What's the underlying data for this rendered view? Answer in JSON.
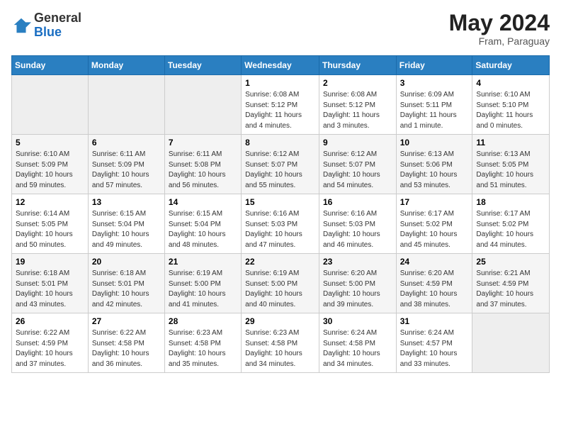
{
  "header": {
    "logo": {
      "general": "General",
      "blue": "Blue"
    },
    "title": "May 2024",
    "location": "Fram, Paraguay"
  },
  "weekdays": [
    "Sunday",
    "Monday",
    "Tuesday",
    "Wednesday",
    "Thursday",
    "Friday",
    "Saturday"
  ],
  "weeks": [
    [
      {
        "day": "",
        "empty": true
      },
      {
        "day": "",
        "empty": true
      },
      {
        "day": "",
        "empty": true
      },
      {
        "day": "1",
        "sunrise": "6:08 AM",
        "sunset": "5:12 PM",
        "daylight": "11 hours and 4 minutes."
      },
      {
        "day": "2",
        "sunrise": "6:08 AM",
        "sunset": "5:12 PM",
        "daylight": "11 hours and 3 minutes."
      },
      {
        "day": "3",
        "sunrise": "6:09 AM",
        "sunset": "5:11 PM",
        "daylight": "11 hours and 1 minute."
      },
      {
        "day": "4",
        "sunrise": "6:10 AM",
        "sunset": "5:10 PM",
        "daylight": "11 hours and 0 minutes."
      }
    ],
    [
      {
        "day": "5",
        "sunrise": "6:10 AM",
        "sunset": "5:09 PM",
        "daylight": "10 hours and 59 minutes."
      },
      {
        "day": "6",
        "sunrise": "6:11 AM",
        "sunset": "5:09 PM",
        "daylight": "10 hours and 57 minutes."
      },
      {
        "day": "7",
        "sunrise": "6:11 AM",
        "sunset": "5:08 PM",
        "daylight": "10 hours and 56 minutes."
      },
      {
        "day": "8",
        "sunrise": "6:12 AM",
        "sunset": "5:07 PM",
        "daylight": "10 hours and 55 minutes."
      },
      {
        "day": "9",
        "sunrise": "6:12 AM",
        "sunset": "5:07 PM",
        "daylight": "10 hours and 54 minutes."
      },
      {
        "day": "10",
        "sunrise": "6:13 AM",
        "sunset": "5:06 PM",
        "daylight": "10 hours and 53 minutes."
      },
      {
        "day": "11",
        "sunrise": "6:13 AM",
        "sunset": "5:05 PM",
        "daylight": "10 hours and 51 minutes."
      }
    ],
    [
      {
        "day": "12",
        "sunrise": "6:14 AM",
        "sunset": "5:05 PM",
        "daylight": "10 hours and 50 minutes."
      },
      {
        "day": "13",
        "sunrise": "6:15 AM",
        "sunset": "5:04 PM",
        "daylight": "10 hours and 49 minutes."
      },
      {
        "day": "14",
        "sunrise": "6:15 AM",
        "sunset": "5:04 PM",
        "daylight": "10 hours and 48 minutes."
      },
      {
        "day": "15",
        "sunrise": "6:16 AM",
        "sunset": "5:03 PM",
        "daylight": "10 hours and 47 minutes."
      },
      {
        "day": "16",
        "sunrise": "6:16 AM",
        "sunset": "5:03 PM",
        "daylight": "10 hours and 46 minutes."
      },
      {
        "day": "17",
        "sunrise": "6:17 AM",
        "sunset": "5:02 PM",
        "daylight": "10 hours and 45 minutes."
      },
      {
        "day": "18",
        "sunrise": "6:17 AM",
        "sunset": "5:02 PM",
        "daylight": "10 hours and 44 minutes."
      }
    ],
    [
      {
        "day": "19",
        "sunrise": "6:18 AM",
        "sunset": "5:01 PM",
        "daylight": "10 hours and 43 minutes."
      },
      {
        "day": "20",
        "sunrise": "6:18 AM",
        "sunset": "5:01 PM",
        "daylight": "10 hours and 42 minutes."
      },
      {
        "day": "21",
        "sunrise": "6:19 AM",
        "sunset": "5:00 PM",
        "daylight": "10 hours and 41 minutes."
      },
      {
        "day": "22",
        "sunrise": "6:19 AM",
        "sunset": "5:00 PM",
        "daylight": "10 hours and 40 minutes."
      },
      {
        "day": "23",
        "sunrise": "6:20 AM",
        "sunset": "5:00 PM",
        "daylight": "10 hours and 39 minutes."
      },
      {
        "day": "24",
        "sunrise": "6:20 AM",
        "sunset": "4:59 PM",
        "daylight": "10 hours and 38 minutes."
      },
      {
        "day": "25",
        "sunrise": "6:21 AM",
        "sunset": "4:59 PM",
        "daylight": "10 hours and 37 minutes."
      }
    ],
    [
      {
        "day": "26",
        "sunrise": "6:22 AM",
        "sunset": "4:59 PM",
        "daylight": "10 hours and 37 minutes."
      },
      {
        "day": "27",
        "sunrise": "6:22 AM",
        "sunset": "4:58 PM",
        "daylight": "10 hours and 36 minutes."
      },
      {
        "day": "28",
        "sunrise": "6:23 AM",
        "sunset": "4:58 PM",
        "daylight": "10 hours and 35 minutes."
      },
      {
        "day": "29",
        "sunrise": "6:23 AM",
        "sunset": "4:58 PM",
        "daylight": "10 hours and 34 minutes."
      },
      {
        "day": "30",
        "sunrise": "6:24 AM",
        "sunset": "4:58 PM",
        "daylight": "10 hours and 34 minutes."
      },
      {
        "day": "31",
        "sunrise": "6:24 AM",
        "sunset": "4:57 PM",
        "daylight": "10 hours and 33 minutes."
      },
      {
        "day": "",
        "empty": true
      }
    ]
  ],
  "labels": {
    "sunrise": "Sunrise:",
    "sunset": "Sunset:",
    "daylight": "Daylight:"
  }
}
